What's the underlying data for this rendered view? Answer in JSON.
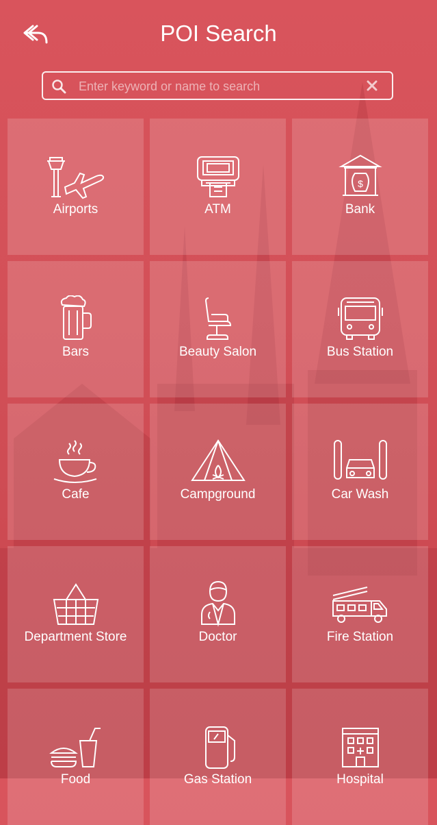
{
  "header": {
    "title": "POI Search",
    "back_icon": "back-arrow-icon"
  },
  "search": {
    "placeholder": "Enter keyword or name to search",
    "value": "",
    "search_icon": "magnifier-icon",
    "clear_icon": "clear-x-icon"
  },
  "colors": {
    "background": "#d35058",
    "tile": "rgba(255,255,255,0.16)",
    "text": "#ffffff"
  },
  "categories": [
    {
      "label": "Airports",
      "icon": "airport-icon"
    },
    {
      "label": "ATM",
      "icon": "atm-icon"
    },
    {
      "label": "Bank",
      "icon": "bank-icon"
    },
    {
      "label": "Bars",
      "icon": "beer-mug-icon"
    },
    {
      "label": "Beauty Salon",
      "icon": "salon-chair-icon"
    },
    {
      "label": "Bus Station",
      "icon": "bus-icon"
    },
    {
      "label": "Cafe",
      "icon": "coffee-cup-icon"
    },
    {
      "label": "Campground",
      "icon": "tent-icon"
    },
    {
      "label": "Car Wash",
      "icon": "car-wash-icon"
    },
    {
      "label": "Department Store",
      "icon": "shopping-basket-icon"
    },
    {
      "label": "Doctor",
      "icon": "doctor-icon"
    },
    {
      "label": "Fire Station",
      "icon": "fire-truck-icon"
    },
    {
      "label": "Food",
      "icon": "burger-drink-icon"
    },
    {
      "label": "Gas Station",
      "icon": "gas-pump-icon"
    },
    {
      "label": "Hospital",
      "icon": "hospital-icon"
    }
  ]
}
